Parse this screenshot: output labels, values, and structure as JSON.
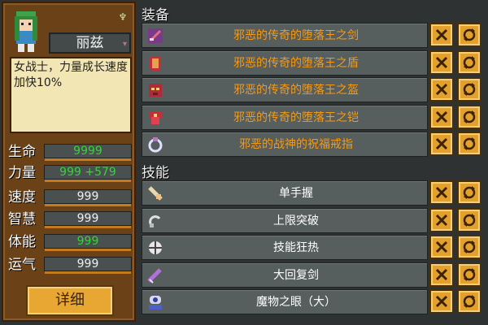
{
  "character": {
    "name": "丽兹",
    "description": "女战士，力量成长速度加快10%",
    "stats": [
      {
        "label": "生命",
        "value": "9999",
        "bonus": "",
        "green": true
      },
      {
        "label": "力量",
        "value": "999",
        "bonus": "+579",
        "green": true
      },
      {
        "label": "速度",
        "value": "999",
        "bonus": "",
        "green": false
      },
      {
        "label": "智慧",
        "value": "999",
        "bonus": "",
        "green": false
      },
      {
        "label": "体能",
        "value": "999",
        "bonus": "",
        "green": true
      },
      {
        "label": "运气",
        "value": "999",
        "bonus": "",
        "green": false
      }
    ],
    "detail_label": "详细"
  },
  "equipment": {
    "title": "装备",
    "items": [
      {
        "name": "邪恶的传奇的堕落王之剑",
        "icon": "sword-icon"
      },
      {
        "name": "邪恶的传奇的堕落王之盾",
        "icon": "shield-icon"
      },
      {
        "name": "邪恶的传奇的堕落王之盔",
        "icon": "helmet-icon"
      },
      {
        "name": "邪恶的传奇的堕落王之铠",
        "icon": "armor-icon"
      },
      {
        "name": "邪恶的战神的祝福戒指",
        "icon": "ring-icon"
      }
    ]
  },
  "skills": {
    "title": "技能",
    "items": [
      {
        "name": "单手握",
        "icon": "hand-grip-icon"
      },
      {
        "name": "上限突破",
        "icon": "limit-break-icon"
      },
      {
        "name": "技能狂热",
        "icon": "skill-frenzy-icon"
      },
      {
        "name": "大回复剑",
        "icon": "heal-sword-icon"
      },
      {
        "name": "魔物之眼（大）",
        "icon": "monster-eye-icon"
      }
    ]
  },
  "buttons": {
    "remove_glyph": "✕",
    "swap_glyph": "⟳"
  }
}
